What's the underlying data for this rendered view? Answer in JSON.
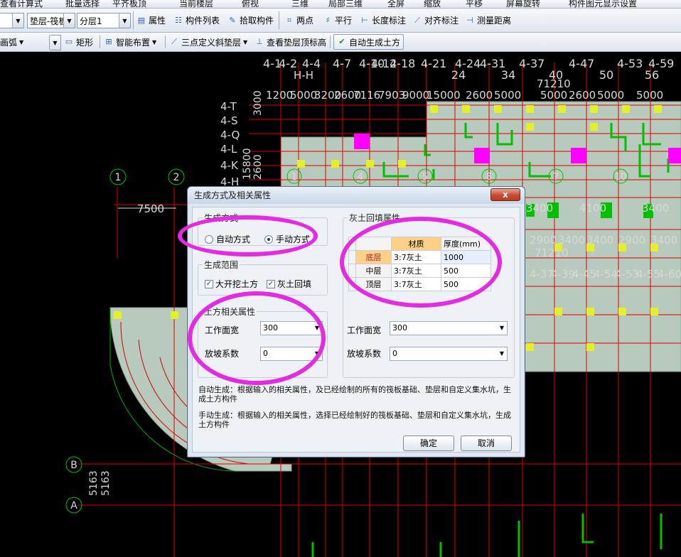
{
  "toolbar_top": {
    "items": [
      "查看计算式",
      "批量选择",
      "平齐板顶",
      "当前楼层",
      "俯视",
      "三维",
      "局部三维",
      "全屏",
      "缩放",
      "平移",
      "屏幕旋转",
      "构件图元显示设置"
    ]
  },
  "toolbar1": {
    "combo_category": "垫层-筏板",
    "combo_layer": "分层1",
    "attr": "属性",
    "list": "构件列表",
    "pick": "拾取构件",
    "two_point": "两点",
    "parallel": "平行",
    "length_mark": "长度标注",
    "align_mark": "对齐标注",
    "measure": "测量距离"
  },
  "toolbar2": {
    "arc": "画弧",
    "rect": "矩形",
    "smart": "智能布置",
    "slope": "三点定义斜垫层",
    "view_top": "查看垫层顶标高",
    "auto_earth": "自动生成土方"
  },
  "cad": {
    "axis_top_labels": [
      "4-1",
      "4-2",
      "4-4",
      "4-7",
      "4-10",
      "4-12",
      "4-18",
      "4-21",
      "4-24",
      "4-31",
      "4-37",
      "4-47",
      "4-53",
      "4-59"
    ],
    "axis_top_numbers": [
      "24",
      "34",
      "40",
      "50",
      "56"
    ],
    "axis_hh": "H-H",
    "dim_71210": "71210",
    "dims_row": [
      "1200",
      "5000",
      "3200",
      "2600",
      "7116",
      "7903",
      "9000",
      "15000",
      "2600",
      "5000",
      "5000",
      "2600",
      "5000",
      "5000"
    ],
    "left_axes": [
      "4-T",
      "4-S",
      "4-Q",
      "4-L",
      "4-K",
      "4-H"
    ],
    "vert_dims": [
      "15800",
      "3000",
      "2600"
    ],
    "grid_circles": [
      "1",
      "2"
    ],
    "inner_circles": [
      "1",
      "4",
      "5",
      "8",
      "7",
      "10"
    ],
    "dim_7500": "7500",
    "right_dims": [
      "3400",
      "4100",
      "3400"
    ],
    "right_row2": [
      "2900",
      "3400",
      "3400",
      "2900",
      "3400"
    ],
    "right_71210": "71210",
    "right_row3": [
      "4-37",
      "4-39",
      "4-45",
      "4-54",
      "4-53",
      "4-55",
      "4-60"
    ],
    "axis_bottom": [
      "B",
      "A"
    ],
    "dim_5163": "5163",
    "colors": {
      "black": "#000000",
      "grid_red": "#e00000",
      "green": "#00c000",
      "slab": "#b8c9bd",
      "magenta": "#ff00ff",
      "yellow": "#e4ef2a",
      "text": "#d8d8d8"
    }
  },
  "dialog": {
    "title": "生成方式及相关属性",
    "close": "x",
    "gen_mode_label": "生成方式",
    "radio_auto": "自动方式",
    "radio_manual": "手动方式",
    "range_label": "生成范围",
    "check_excavate": "大开挖土方",
    "check_backfill": "灰土回填",
    "earth_props_label": "土方相关属性",
    "work_width_label": "工作面宽",
    "work_width_value": "300",
    "slope_label": "放坡系数",
    "slope_value": "0",
    "backfill_label": "灰土回填属性",
    "table": {
      "col_material": "材质",
      "col_thickness": "厚度(mm)",
      "rows": [
        {
          "name": "底层",
          "material": "3:7灰土",
          "thickness": "1000"
        },
        {
          "name": "中层",
          "material": "3:7灰土",
          "thickness": "500"
        },
        {
          "name": "顶层",
          "material": "3:7灰土",
          "thickness": "500"
        }
      ]
    },
    "work_width_label2": "工作面宽",
    "work_width_value2": "300",
    "slope_label2": "放坡系数",
    "slope_value2": "0",
    "desc_auto": "自动生成：根据输入的相关属性，及已经绘制的所有的筏板基础、垫层和自定义集水坑，生成土方构件",
    "desc_manual": "手动生成：根据输入的相关属性，选择已经绘制好的筏板基础、垫层和自定义集水坑，生成土方构件",
    "ok": "确定",
    "cancel": "取消"
  }
}
